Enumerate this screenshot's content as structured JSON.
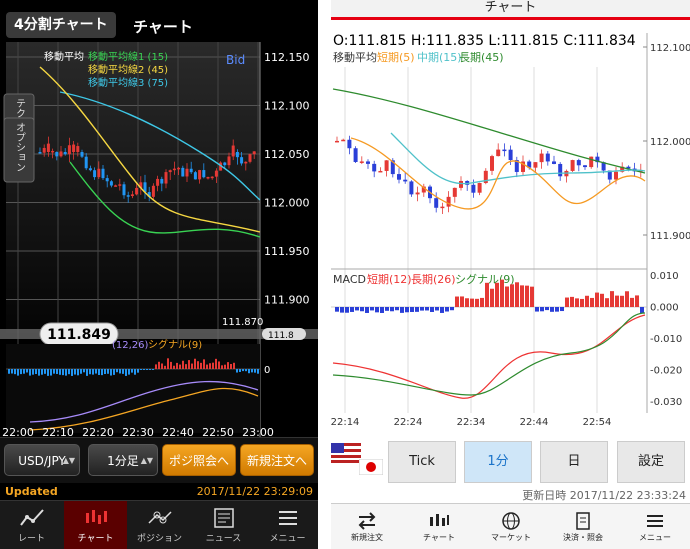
{
  "left": {
    "header": {
      "tab_label": "4分割チャート",
      "title": "チャート"
    },
    "chart": {
      "bid_label": "Bid",
      "indicator_title": "移動平均",
      "ma_legend": [
        {
          "label": "移動平均線1 (15)",
          "color": "#39d353"
        },
        {
          "label": "移動平均線2 (45)",
          "color": "#f5d742"
        },
        {
          "label": "移動平均線3 (75)",
          "color": "#3ec7e6"
        }
      ],
      "side_tab_1": "テクニカル",
      "side_tab_2": "オプション",
      "price_labels": [
        "112.150",
        "112.100",
        "112.050",
        "112.000",
        "111.950",
        "111.900"
      ],
      "low_label": "111.870",
      "current_price": "111.849",
      "macd_params": "(12,26)",
      "macd_signal_label": "シグナル(9)",
      "macd_zero": "0",
      "time_labels": [
        "22:00",
        "22:10",
        "22:20",
        "22:30",
        "22:40",
        "22:50",
        "23:00"
      ]
    },
    "toolbar": {
      "pair": "USD/JPY",
      "interval": "1分足",
      "position_btn": "ポジ照会へ",
      "new_order_btn": "新規注文へ"
    },
    "status": {
      "updated": "Updated",
      "timestamp": "2017/11/22 23:29:09"
    },
    "nav": [
      "レート",
      "チャート",
      "ポジション",
      "ニュース",
      "メニュー"
    ]
  },
  "right": {
    "header": "チャート",
    "chart": {
      "ohlc": "O:111.815 H:111.835 L:111.815 C:111.834",
      "ma_title": "移動平均",
      "ma_short": "短期(5)",
      "ma_mid": "中期(15)",
      "ma_long": "長期(45)",
      "price_labels": [
        "112.100",
        "112.000",
        "111.900"
      ],
      "macd_title": "MACD",
      "macd_short": "短期(12)",
      "macd_long": "長期(26)",
      "macd_signal": "シグナル(9)",
      "macd_labels": [
        "0.010",
        "0.000",
        "-0.010",
        "-0.020",
        "-0.030"
      ],
      "time_labels": [
        "22:14",
        "22:24",
        "22:34",
        "22:44",
        "22:54"
      ]
    },
    "controls": {
      "tick": "Tick",
      "one_min": "1分",
      "day": "日",
      "settings": "設定"
    },
    "updated": "更新日時 2017/11/22 23:33:24",
    "nav": [
      "新規注文",
      "チャート",
      "マーケット",
      "決済・照会",
      "メニュー"
    ]
  }
}
